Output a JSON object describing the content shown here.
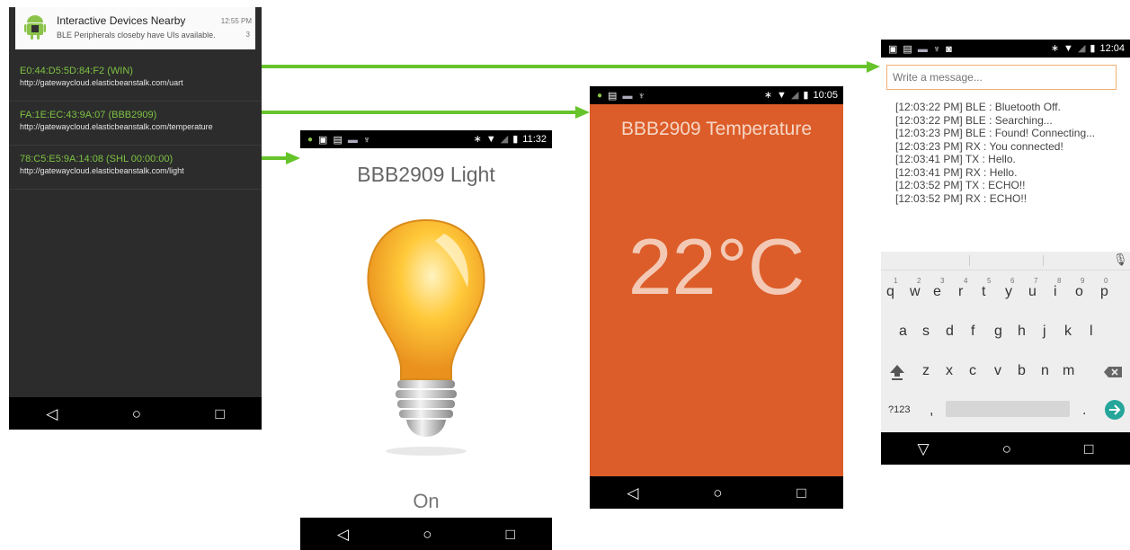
{
  "notification": {
    "title": "Interactive Devices Nearby",
    "time": "12:55 PM",
    "body": "BLE Peripherals closeby have UIs available.",
    "count": "3"
  },
  "devices": [
    {
      "address": "E0:44:D5:5D:84:F2 (WIN)",
      "url": "http://gatewaycloud.elasticbeanstalk.com/uart"
    },
    {
      "address": "FA:1E:EC:43:9A:07 (BBB2909)",
      "url": "http://gatewaycloud.elasticbeanstalk.com/temperature"
    },
    {
      "address": "78:C5:E5:9A:14:08 (SHL 00:00:00)",
      "url": "http://gatewaycloud.elasticbeanstalk.com/light"
    }
  ],
  "light_app": {
    "time": "11:32",
    "title": "BBB2909 Light",
    "state": "On"
  },
  "temp_app": {
    "time": "10:05",
    "title": "BBB2909 Temperature",
    "value": "22°C"
  },
  "uart_app": {
    "time": "12:04",
    "placeholder": "Write a message...",
    "log": [
      "[12:03:22 PM] BLE : Bluetooth Off.",
      "[12:03:22 PM] BLE : Searching...",
      "[12:03:23 PM] BLE : Found! Connecting...",
      "[12:03:23 PM] RX : You connected!",
      "[12:03:41 PM] TX : Hello.",
      "[12:03:41 PM] RX : Hello.",
      "[12:03:52 PM] TX : ECHO!!",
      "[12:03:52 PM] RX : ECHO!!"
    ],
    "keyboard": {
      "row1": [
        "q",
        "w",
        "e",
        "r",
        "t",
        "y",
        "u",
        "i",
        "o",
        "p"
      ],
      "row1_numbers": [
        "1",
        "2",
        "3",
        "4",
        "5",
        "6",
        "7",
        "8",
        "9",
        "0"
      ],
      "row2": [
        "a",
        "s",
        "d",
        "f",
        "g",
        "h",
        "j",
        "k",
        "l"
      ],
      "row3": [
        "z",
        "x",
        "c",
        "v",
        "b",
        "n",
        "m"
      ],
      "symbols_key": "?123",
      "comma": ",",
      "period": "."
    }
  },
  "icons": {
    "back": "back-icon",
    "home": "home-icon",
    "recents": "recents-icon",
    "bluetooth": "bluetooth-icon",
    "wifi": "wifi-icon",
    "battery": "battery-icon",
    "android": "android-icon",
    "mic": "mic-icon",
    "shift": "shift-icon",
    "backspace": "backspace-icon",
    "enter": "enter-icon",
    "arrow": "flow-arrow-icon"
  },
  "colors": {
    "accent_green": "#7dc243",
    "temp_bg": "#dc5d29",
    "notif_dark": "#2c2c2c",
    "input_border": "#f0b070",
    "enter_key": "#26a69a"
  }
}
